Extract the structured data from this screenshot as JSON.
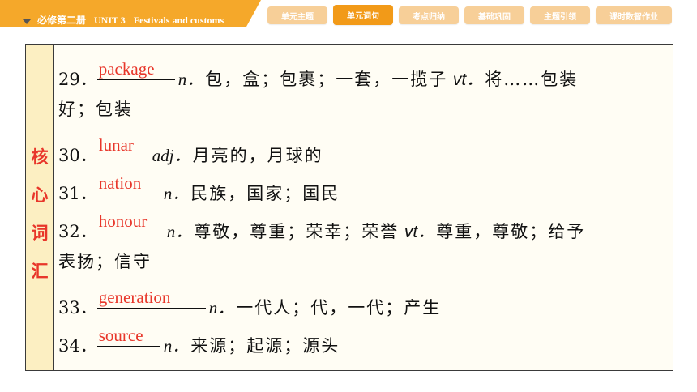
{
  "header": {
    "book": "必修第二册",
    "unit": "UNIT 3",
    "topic": "Festivals and customs",
    "tabs": [
      {
        "label": "单元主题"
      },
      {
        "label": "单元词句"
      },
      {
        "label": "考点归纳"
      },
      {
        "label": "基础巩固"
      },
      {
        "label": "主题引领"
      },
      {
        "label": "课时数智作业"
      }
    ],
    "active_tab": "单元词句"
  },
  "side": {
    "label_chars": [
      "核",
      "心",
      "词",
      "汇"
    ]
  },
  "colors": {
    "accent": "#f29a18",
    "tab": "#f7cf98",
    "answer": "#e8362a",
    "side_bg": "#fcefc2"
  },
  "entries": [
    {
      "num": "29．",
      "answer": "package",
      "pos1": "n．",
      "def1": "包，盒；包裹；一套，一揽子",
      "pos2": "vt．",
      "def2": "将……包装",
      "wrap": "好；包装"
    },
    {
      "num": "30．",
      "answer": "lunar",
      "pos1": "adj．",
      "def1": "月亮的，月球的"
    },
    {
      "num": "31．",
      "answer": "nation",
      "pos1": "n．",
      "def1": "民族，国家；国民"
    },
    {
      "num": "32．",
      "answer": "honour",
      "pos1": "n．",
      "def1": "尊敬，尊重；荣幸；荣誉",
      "pos2": "vt．",
      "def2": "尊重，尊敬；给予",
      "wrap": "表扬；信守"
    },
    {
      "num": "33．",
      "answer": "generation",
      "pos1": "n．",
      "def1": "一代人；代，一代；产生"
    },
    {
      "num": "34．",
      "answer": "source",
      "pos1": "n．",
      "def1": "来源；起源；源头"
    }
  ]
}
